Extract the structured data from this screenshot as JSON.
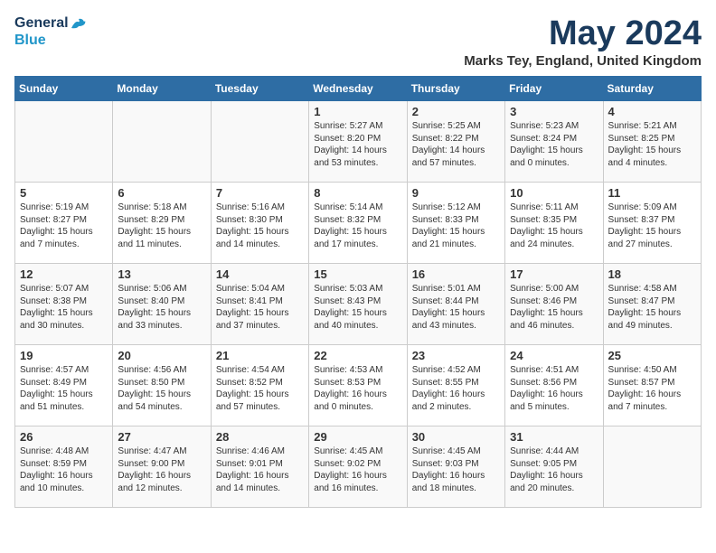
{
  "logo": {
    "line1": "General",
    "line2": "Blue"
  },
  "title": "May 2024",
  "subtitle": "Marks Tey, England, United Kingdom",
  "days_of_week": [
    "Sunday",
    "Monday",
    "Tuesday",
    "Wednesday",
    "Thursday",
    "Friday",
    "Saturday"
  ],
  "weeks": [
    [
      {
        "day": "",
        "info": ""
      },
      {
        "day": "",
        "info": ""
      },
      {
        "day": "",
        "info": ""
      },
      {
        "day": "1",
        "info": "Sunrise: 5:27 AM\nSunset: 8:20 PM\nDaylight: 14 hours\nand 53 minutes."
      },
      {
        "day": "2",
        "info": "Sunrise: 5:25 AM\nSunset: 8:22 PM\nDaylight: 14 hours\nand 57 minutes."
      },
      {
        "day": "3",
        "info": "Sunrise: 5:23 AM\nSunset: 8:24 PM\nDaylight: 15 hours\nand 0 minutes."
      },
      {
        "day": "4",
        "info": "Sunrise: 5:21 AM\nSunset: 8:25 PM\nDaylight: 15 hours\nand 4 minutes."
      }
    ],
    [
      {
        "day": "5",
        "info": "Sunrise: 5:19 AM\nSunset: 8:27 PM\nDaylight: 15 hours\nand 7 minutes."
      },
      {
        "day": "6",
        "info": "Sunrise: 5:18 AM\nSunset: 8:29 PM\nDaylight: 15 hours\nand 11 minutes."
      },
      {
        "day": "7",
        "info": "Sunrise: 5:16 AM\nSunset: 8:30 PM\nDaylight: 15 hours\nand 14 minutes."
      },
      {
        "day": "8",
        "info": "Sunrise: 5:14 AM\nSunset: 8:32 PM\nDaylight: 15 hours\nand 17 minutes."
      },
      {
        "day": "9",
        "info": "Sunrise: 5:12 AM\nSunset: 8:33 PM\nDaylight: 15 hours\nand 21 minutes."
      },
      {
        "day": "10",
        "info": "Sunrise: 5:11 AM\nSunset: 8:35 PM\nDaylight: 15 hours\nand 24 minutes."
      },
      {
        "day": "11",
        "info": "Sunrise: 5:09 AM\nSunset: 8:37 PM\nDaylight: 15 hours\nand 27 minutes."
      }
    ],
    [
      {
        "day": "12",
        "info": "Sunrise: 5:07 AM\nSunset: 8:38 PM\nDaylight: 15 hours\nand 30 minutes."
      },
      {
        "day": "13",
        "info": "Sunrise: 5:06 AM\nSunset: 8:40 PM\nDaylight: 15 hours\nand 33 minutes."
      },
      {
        "day": "14",
        "info": "Sunrise: 5:04 AM\nSunset: 8:41 PM\nDaylight: 15 hours\nand 37 minutes."
      },
      {
        "day": "15",
        "info": "Sunrise: 5:03 AM\nSunset: 8:43 PM\nDaylight: 15 hours\nand 40 minutes."
      },
      {
        "day": "16",
        "info": "Sunrise: 5:01 AM\nSunset: 8:44 PM\nDaylight: 15 hours\nand 43 minutes."
      },
      {
        "day": "17",
        "info": "Sunrise: 5:00 AM\nSunset: 8:46 PM\nDaylight: 15 hours\nand 46 minutes."
      },
      {
        "day": "18",
        "info": "Sunrise: 4:58 AM\nSunset: 8:47 PM\nDaylight: 15 hours\nand 49 minutes."
      }
    ],
    [
      {
        "day": "19",
        "info": "Sunrise: 4:57 AM\nSunset: 8:49 PM\nDaylight: 15 hours\nand 51 minutes."
      },
      {
        "day": "20",
        "info": "Sunrise: 4:56 AM\nSunset: 8:50 PM\nDaylight: 15 hours\nand 54 minutes."
      },
      {
        "day": "21",
        "info": "Sunrise: 4:54 AM\nSunset: 8:52 PM\nDaylight: 15 hours\nand 57 minutes."
      },
      {
        "day": "22",
        "info": "Sunrise: 4:53 AM\nSunset: 8:53 PM\nDaylight: 16 hours\nand 0 minutes."
      },
      {
        "day": "23",
        "info": "Sunrise: 4:52 AM\nSunset: 8:55 PM\nDaylight: 16 hours\nand 2 minutes."
      },
      {
        "day": "24",
        "info": "Sunrise: 4:51 AM\nSunset: 8:56 PM\nDaylight: 16 hours\nand 5 minutes."
      },
      {
        "day": "25",
        "info": "Sunrise: 4:50 AM\nSunset: 8:57 PM\nDaylight: 16 hours\nand 7 minutes."
      }
    ],
    [
      {
        "day": "26",
        "info": "Sunrise: 4:48 AM\nSunset: 8:59 PM\nDaylight: 16 hours\nand 10 minutes."
      },
      {
        "day": "27",
        "info": "Sunrise: 4:47 AM\nSunset: 9:00 PM\nDaylight: 16 hours\nand 12 minutes."
      },
      {
        "day": "28",
        "info": "Sunrise: 4:46 AM\nSunset: 9:01 PM\nDaylight: 16 hours\nand 14 minutes."
      },
      {
        "day": "29",
        "info": "Sunrise: 4:45 AM\nSunset: 9:02 PM\nDaylight: 16 hours\nand 16 minutes."
      },
      {
        "day": "30",
        "info": "Sunrise: 4:45 AM\nSunset: 9:03 PM\nDaylight: 16 hours\nand 18 minutes."
      },
      {
        "day": "31",
        "info": "Sunrise: 4:44 AM\nSunset: 9:05 PM\nDaylight: 16 hours\nand 20 minutes."
      },
      {
        "day": "",
        "info": ""
      }
    ]
  ]
}
